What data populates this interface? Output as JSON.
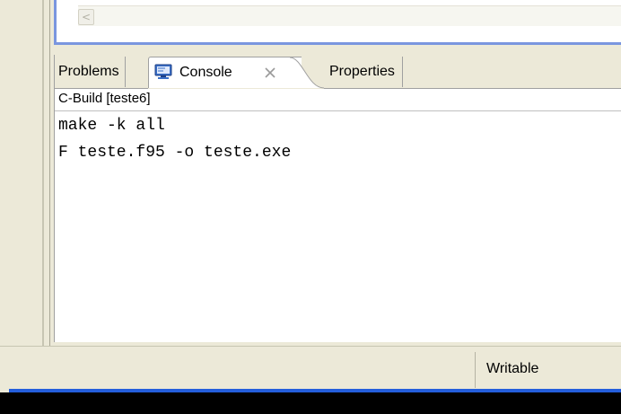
{
  "editor": {
    "scroll_left_glyph": "<"
  },
  "tabs": {
    "problems": "Problems",
    "console": "Console",
    "properties": "Properties"
  },
  "console": {
    "title": "C-Build [teste6]",
    "lines": [
      "make -k all",
      "F teste.f95 -o teste.exe"
    ]
  },
  "status": {
    "writable": "Writable"
  },
  "colors": {
    "active_border": "#7a96df",
    "taskbar_blue": "#245edb",
    "chrome": "#ece9d8"
  }
}
